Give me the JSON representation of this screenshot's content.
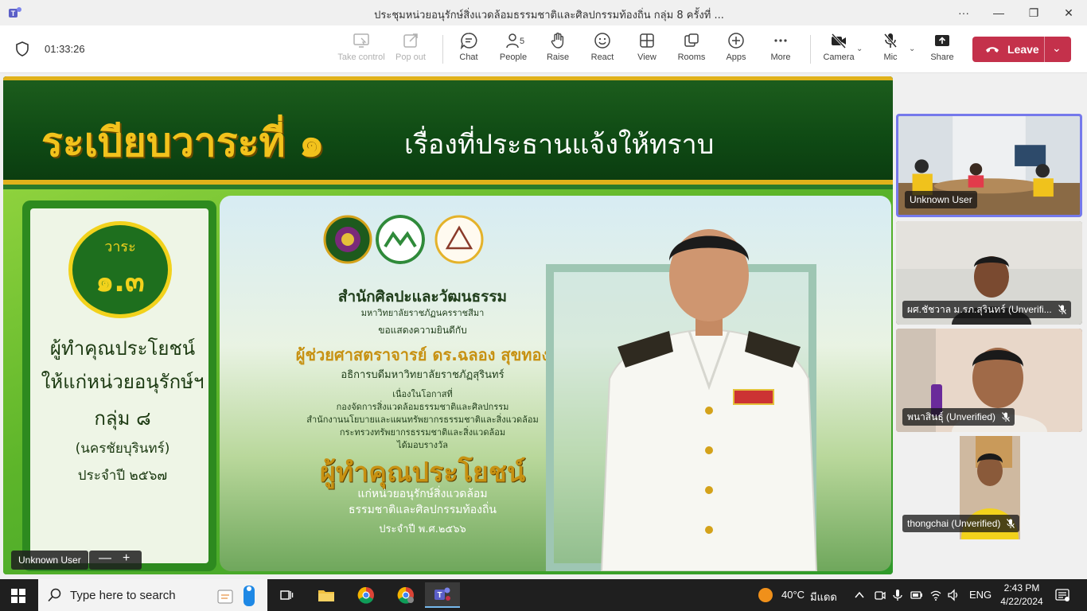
{
  "window": {
    "title": "ประชุมหน่วยอนุรักษ์สิ่งแวดล้อมธรรมชาติและศิลปกรรมท้องถิ่น กลุ่ม 8 ครั้งที่ ...",
    "more": "···",
    "minimize": "—",
    "maximize": "❐",
    "close": "✕"
  },
  "toolbar": {
    "timer": "01:33:26",
    "take_control": "Take control",
    "pop_out": "Pop out",
    "chat": "Chat",
    "people": "People",
    "people_count": "5",
    "raise": "Raise",
    "react": "React",
    "view": "View",
    "rooms": "Rooms",
    "apps": "Apps",
    "more": "More",
    "camera": "Camera",
    "mic": "Mic",
    "share": "Share",
    "leave": "Leave"
  },
  "slide": {
    "agenda_title": "ระเบียบวาระที่ ๑",
    "agenda_subtitle": "เรื่องที่ประธานแจ้งให้ทราบ",
    "badge_label": "วาระ",
    "badge_number": "๑.๓",
    "panel_line1": "ผู้ทำคุณประโยชน์",
    "panel_line2": "ให้แก่หน่วยอนุรักษ์ฯ",
    "panel_line3": "กลุ่ม ๘",
    "panel_line4": "(นครชัยบุรินทร์)",
    "panel_line5": "ประจำปี ๒๕๖๗",
    "award": {
      "org": "สำนักศิลปะและวัฒนธรรม",
      "univ": "มหาวิทยาลัยราชภัฏนครราชสีมา",
      "congrats": "ขอแสดงความยินดีกับ",
      "person": "ผู้ช่วยศาสตราจารย์ ดร.ฉลอง สุขทอง",
      "position": "อธิการบดีมหาวิทยาลัยราชภัฏสุรินทร์",
      "occasion": "เนื่องในโอกาสที่",
      "dept1": "กองจัดการสิ่งแวดล้อมธรรมชาติและศิลปกรรม",
      "dept2": "สำนักงานนโยบายและแผนทรัพยากรธรรมชาติและสิ่งแวดล้อม",
      "dept3": "กระทรวงทรัพยากรธรรมชาติและสิ่งแวดล้อม",
      "received": "ได้มอบรางวัล",
      "award_title": "ผู้ทำคุณประโยชน์",
      "award_line1": "แก่หน่วยอนุรักษ์สิ่งแวดล้อม",
      "award_line2": "ธรรมชาติและศิลปกรรมท้องถิ่น",
      "year": "ประจำปี พ.ศ.๒๕๖๖"
    }
  },
  "stage": {
    "presenter_name": "Unknown User",
    "zoom_out": "—",
    "zoom_in": "+"
  },
  "participants": [
    {
      "name": "Unknown User",
      "muted": false
    },
    {
      "name": "ผศ.ชัชวาล ม.รภ.สุรินทร์ (Unverifi...",
      "muted": true
    },
    {
      "name": "พนาสินธุ์ (Unverified)",
      "muted": true
    },
    {
      "name": "thongchai (Unverified)",
      "muted": true
    }
  ],
  "taskbar": {
    "search_placeholder": "Type here to search",
    "weather_temp": "40°C",
    "weather_desc": "มีแดด",
    "lang": "ENG",
    "time": "2:43 PM",
    "date": "4/22/2024",
    "colors": {
      "accent": "#76b9ed",
      "leave": "#c4314b",
      "teams": "#5b5fc7"
    }
  }
}
